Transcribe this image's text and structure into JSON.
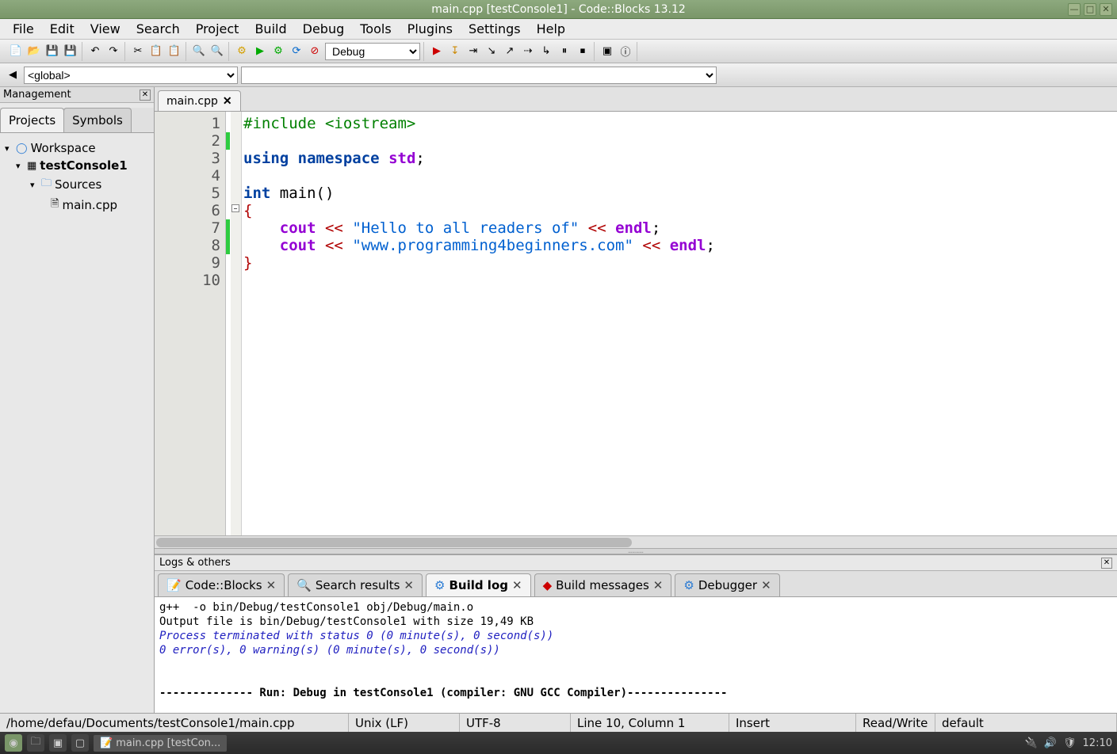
{
  "window": {
    "title": "main.cpp [testConsole1] - Code::Blocks 13.12"
  },
  "menu": {
    "file": "File",
    "edit": "Edit",
    "view": "View",
    "search": "Search",
    "project": "Project",
    "build": "Build",
    "debug": "Debug",
    "tools": "Tools",
    "plugins": "Plugins",
    "settings": "Settings",
    "help": "Help"
  },
  "toolbar": {
    "build_target_label": "Debug"
  },
  "scope": {
    "value": "<global>"
  },
  "management": {
    "title": "Management",
    "tabs": {
      "projects": "Projects",
      "symbols": "Symbols"
    },
    "tree": {
      "workspace": "Workspace",
      "project": "testConsole1",
      "sources": "Sources",
      "file": "main.cpp"
    }
  },
  "editor": {
    "tab_name": "main.cpp",
    "line_numbers": [
      "1",
      "2",
      "3",
      "4",
      "5",
      "6",
      "7",
      "8",
      "9",
      "10"
    ],
    "code": {
      "l1_include": "#include <iostream>",
      "l3_using": "using",
      "l3_namespace": "namespace",
      "l3_std": "std",
      "l3_semi": ";",
      "l5_int": "int",
      "l5_main": "main",
      "l5_par": "()",
      "l6_open": "{",
      "l7_cout": "cout",
      "l7_op1": "<<",
      "l7_str": "\"Hello to all readers of\"",
      "l7_op2": "<<",
      "l7_endl": "endl",
      "l7_semi": ";",
      "l8_cout": "cout",
      "l8_op1": "<<",
      "l8_str": "\"www.programming4beginners.com\"",
      "l8_op2": "<<",
      "l8_endl": "endl",
      "l8_semi": ";",
      "l9_close": "}",
      "indent": "    "
    }
  },
  "logs": {
    "title": "Logs & others",
    "tabs": {
      "cb": "Code::Blocks",
      "sr": "Search results",
      "bl": "Build log",
      "bm": "Build messages",
      "dbg": "Debugger"
    },
    "body": {
      "l1": "g++  -o bin/Debug/testConsole1 obj/Debug/main.o",
      "l2": "Output file is bin/Debug/testConsole1 with size 19,49 KB",
      "l3": "Process terminated with status 0 (0 minute(s), 0 second(s))",
      "l4": "0 error(s), 0 warning(s) (0 minute(s), 0 second(s))",
      "blank": " ",
      "l5": "-------------- Run: Debug in testConsole1 (compiler: GNU GCC Compiler)---------------"
    }
  },
  "status": {
    "path": "/home/defau/Documents/testConsole1/main.cpp",
    "eol": "Unix (LF)",
    "enc": "UTF-8",
    "caret": "Line 10, Column 1",
    "insert": "Insert",
    "rw": "Read/Write",
    "mode": "default"
  },
  "taskbar": {
    "app": "main.cpp [testCon...",
    "clock": "12:10"
  }
}
